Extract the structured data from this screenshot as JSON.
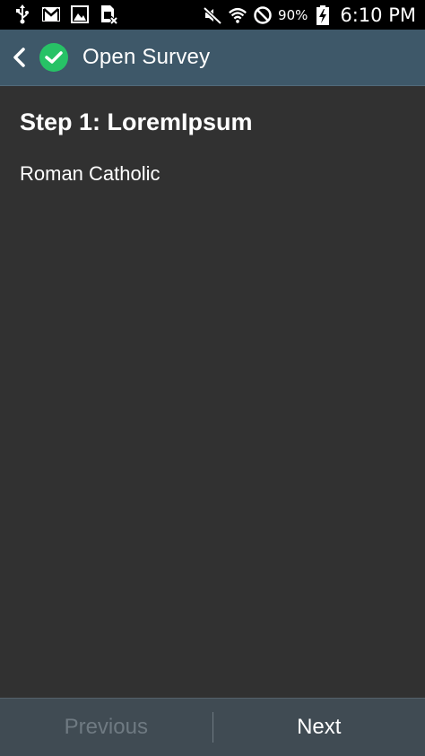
{
  "status_bar": {
    "icons_left": [
      "usb-icon",
      "gmail-icon",
      "gallery-icon",
      "sim-blocked-icon"
    ],
    "icons_right": [
      "mute-icon",
      "wifi-icon",
      "do-not-disturb-icon",
      "battery-charging-icon"
    ],
    "battery": "90%",
    "time": "6:10 PM"
  },
  "action_bar": {
    "title": "Open Survey",
    "accent_color": "#27c266"
  },
  "content": {
    "step_title": "Step 1: LoremIpsum",
    "answer": "Roman Catholic"
  },
  "bottom_nav": {
    "previous_label": "Previous",
    "next_label": "Next"
  }
}
